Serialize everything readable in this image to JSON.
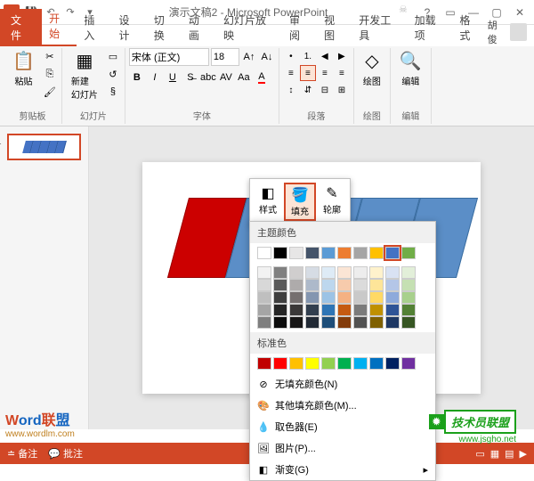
{
  "titlebar": {
    "app_badge": "P",
    "title": "演示文稿2 - Microsoft PowerPoint"
  },
  "tabs": {
    "file": "文件",
    "items": [
      "开始",
      "插入",
      "设计",
      "切换",
      "动画",
      "幻灯片放映",
      "审阅",
      "视图",
      "开发工具",
      "加载项",
      "格式"
    ],
    "active_index": 0,
    "user": "胡俊"
  },
  "ribbon": {
    "clipboard": {
      "paste": "粘贴",
      "label": "剪贴板"
    },
    "slides": {
      "new": "新建\n幻灯片",
      "label": "幻灯片"
    },
    "font": {
      "family": "宋体 (正文)",
      "size": "18",
      "label": "字体"
    },
    "paragraph": {
      "label": "段落"
    },
    "drawing": {
      "label": "绘图",
      "btn": "绘图"
    },
    "editing": {
      "label": "编辑",
      "btn": "编辑"
    }
  },
  "thumbnail": {
    "number": "1"
  },
  "mini_toolbar": {
    "style": "样式",
    "fill": "填充",
    "outline": "轮廓"
  },
  "color_popup": {
    "theme_header": "主题颜色",
    "standard_header": "标准色",
    "no_fill": "无填充颜色(N)",
    "more_colors": "其他填充颜色(M)...",
    "eyedropper": "取色器(E)",
    "picture": "图片(P)...",
    "gradient": "渐变(G)",
    "theme_row1": [
      "#ffffff",
      "#000000",
      "#e7e6e6",
      "#44546a",
      "#5b9bd5",
      "#ed7d31",
      "#a5a5a5",
      "#ffc000",
      "#4472c4",
      "#70ad47"
    ],
    "theme_tints": [
      [
        "#f2f2f2",
        "#808080",
        "#d0cece",
        "#d6dce4",
        "#deebf6",
        "#fbe5d5",
        "#ededed",
        "#fff2cc",
        "#d9e2f3",
        "#e2efd9"
      ],
      [
        "#d8d8d8",
        "#595959",
        "#aeabab",
        "#adb9ca",
        "#bdd7ee",
        "#f7cbac",
        "#dbdbdb",
        "#fee599",
        "#b4c6e7",
        "#c5e0b3"
      ],
      [
        "#bfbfbf",
        "#3f3f3f",
        "#757070",
        "#8496b0",
        "#9cc3e5",
        "#f4b183",
        "#c9c9c9",
        "#ffd965",
        "#8eaadb",
        "#a8d08d"
      ],
      [
        "#a5a5a5",
        "#262626",
        "#3a3838",
        "#323f4f",
        "#2e75b5",
        "#c55a11",
        "#7b7b7b",
        "#bf9000",
        "#2f5496",
        "#538135"
      ],
      [
        "#7f7f7f",
        "#0c0c0c",
        "#171616",
        "#222a35",
        "#1e4e79",
        "#833c0b",
        "#525252",
        "#7f6000",
        "#1f3864",
        "#375623"
      ]
    ],
    "standard_colors": [
      "#c00000",
      "#ff0000",
      "#ffc000",
      "#ffff00",
      "#92d050",
      "#00b050",
      "#00b0f0",
      "#0070c0",
      "#002060",
      "#7030a0"
    ]
  },
  "statusbar": {
    "notes": "备注",
    "comments": "批注"
  },
  "watermarks": {
    "wm1_text": "Word联盟",
    "wm1_url": "www.wordlm.com",
    "wm2_text": "技术员联盟",
    "wm2_url": "www.jsgho.net"
  }
}
